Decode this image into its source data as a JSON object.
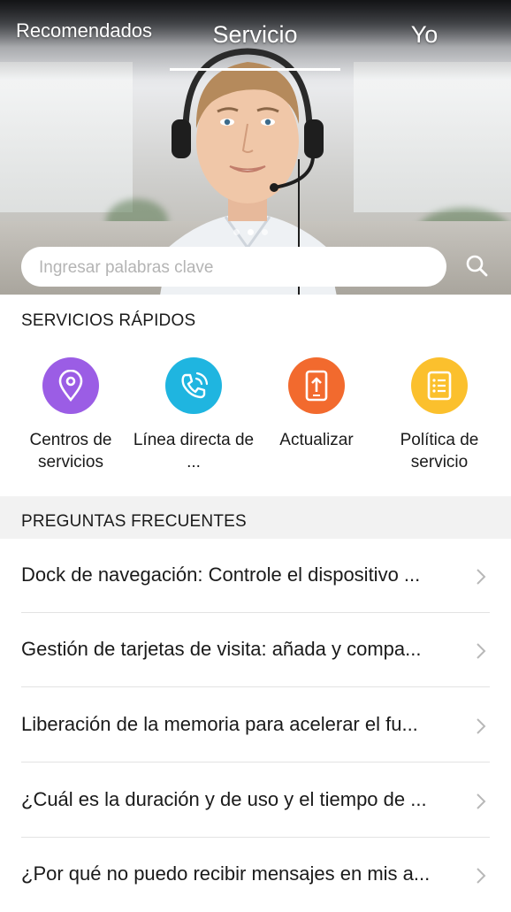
{
  "tabs": [
    {
      "label": "Recomendados"
    },
    {
      "label": "Servicio"
    },
    {
      "label": "Yo"
    }
  ],
  "active_tab": "Servicio",
  "carousel": {
    "total": 3,
    "active": 1
  },
  "search": {
    "placeholder": "Ingresar palabras clave"
  },
  "quick_services": {
    "title": "SERVICIOS RÁPIDOS",
    "items": [
      {
        "label": "Centros de servicios",
        "icon": "location-pin-icon",
        "color": "#9b5de5"
      },
      {
        "label": "Línea directa de ...",
        "icon": "phone-call-icon",
        "color": "#1fb5e0"
      },
      {
        "label": "Actualizar",
        "icon": "phone-update-icon",
        "color": "#f26a2e"
      },
      {
        "label": "Política de servicio",
        "icon": "document-icon",
        "color": "#fbc02d"
      }
    ]
  },
  "faq": {
    "title": "PREGUNTAS FRECUENTES",
    "items": [
      {
        "text": "Dock de navegación: Controle el dispositivo ..."
      },
      {
        "text": "Gestión de tarjetas de visita: añada y compa..."
      },
      {
        "text": "Liberación de la memoria para acelerar el fu..."
      },
      {
        "text": "¿Cuál es la duración y de uso y el tiempo de ..."
      },
      {
        "text": "¿Por qué no puedo recibir mensajes en mis a..."
      }
    ]
  }
}
